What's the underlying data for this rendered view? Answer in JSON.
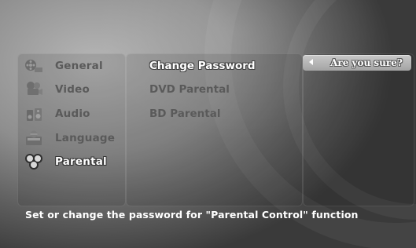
{
  "sidebar": {
    "items": [
      {
        "label": "General",
        "icon": "film-reel-icon",
        "active": false
      },
      {
        "label": "Video",
        "icon": "film-camera-icon",
        "active": false
      },
      {
        "label": "Audio",
        "icon": "audio-speaker-icon",
        "active": false
      },
      {
        "label": "Language",
        "icon": "language-globe-icon",
        "active": false
      },
      {
        "label": "Parental",
        "icon": "parental-family-icon",
        "active": true
      }
    ]
  },
  "submenu": {
    "items": [
      {
        "label": "Change Password",
        "active": true
      },
      {
        "label": "DVD Parental",
        "active": false
      },
      {
        "label": "BD Parental",
        "active": false
      }
    ]
  },
  "confirm": {
    "label": "Are you sure?"
  },
  "help": {
    "text": "Set or change the password for \"Parental Control\" function"
  },
  "colors": {
    "text_inactive": "#5a5a5a",
    "text_active": "#ffffff",
    "background": "#8e8e8e"
  }
}
